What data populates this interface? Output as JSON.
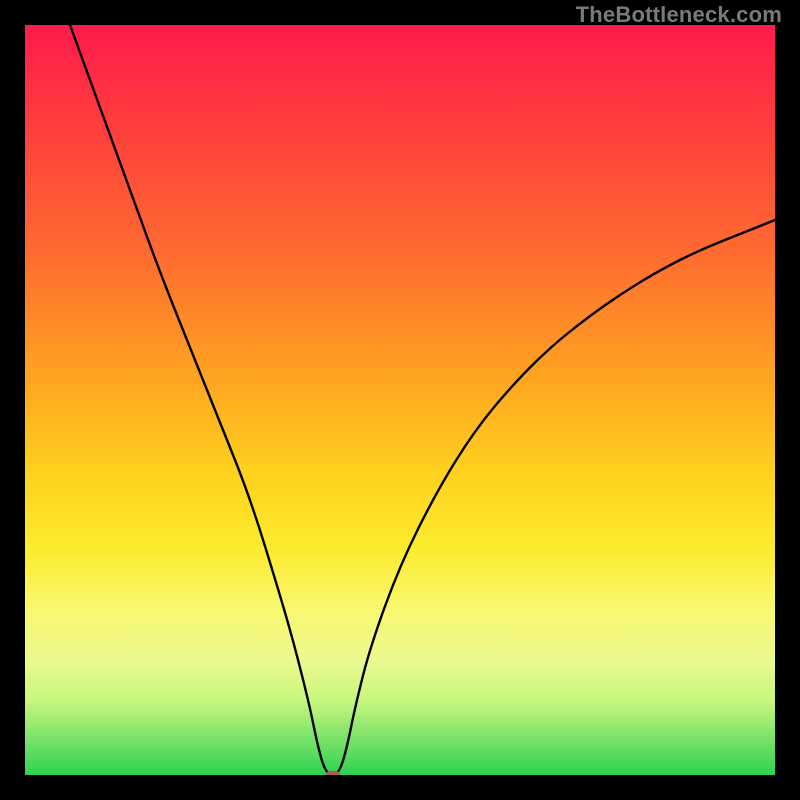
{
  "watermark": "TheBottleneck.com",
  "colors": {
    "frame_bg": "#000000",
    "watermark": "#7a7a7a",
    "curve": "#000000",
    "marker": "#b15a5a"
  },
  "chart_data": {
    "type": "line",
    "title": "",
    "xlabel": "",
    "ylabel": "",
    "xlim": [
      0,
      100
    ],
    "ylim": [
      0,
      100
    ],
    "grid": false,
    "legend": false,
    "marker": {
      "x": 41,
      "y": 0
    },
    "series": [
      {
        "name": "bottleneck-curve",
        "x": [
          6,
          10,
          14,
          18,
          22,
          26,
          30,
          34,
          36,
          38,
          39,
          40,
          41,
          42,
          43,
          44,
          46,
          50,
          55,
          60,
          65,
          70,
          75,
          80,
          85,
          90,
          95,
          100
        ],
        "y": [
          100,
          89,
          78,
          67,
          57,
          47,
          37,
          24,
          17,
          9,
          4,
          0.5,
          0,
          0.5,
          4,
          9,
          17,
          28,
          38,
          46,
          52,
          57,
          61,
          64.5,
          67.5,
          70,
          72,
          74
        ]
      }
    ]
  }
}
